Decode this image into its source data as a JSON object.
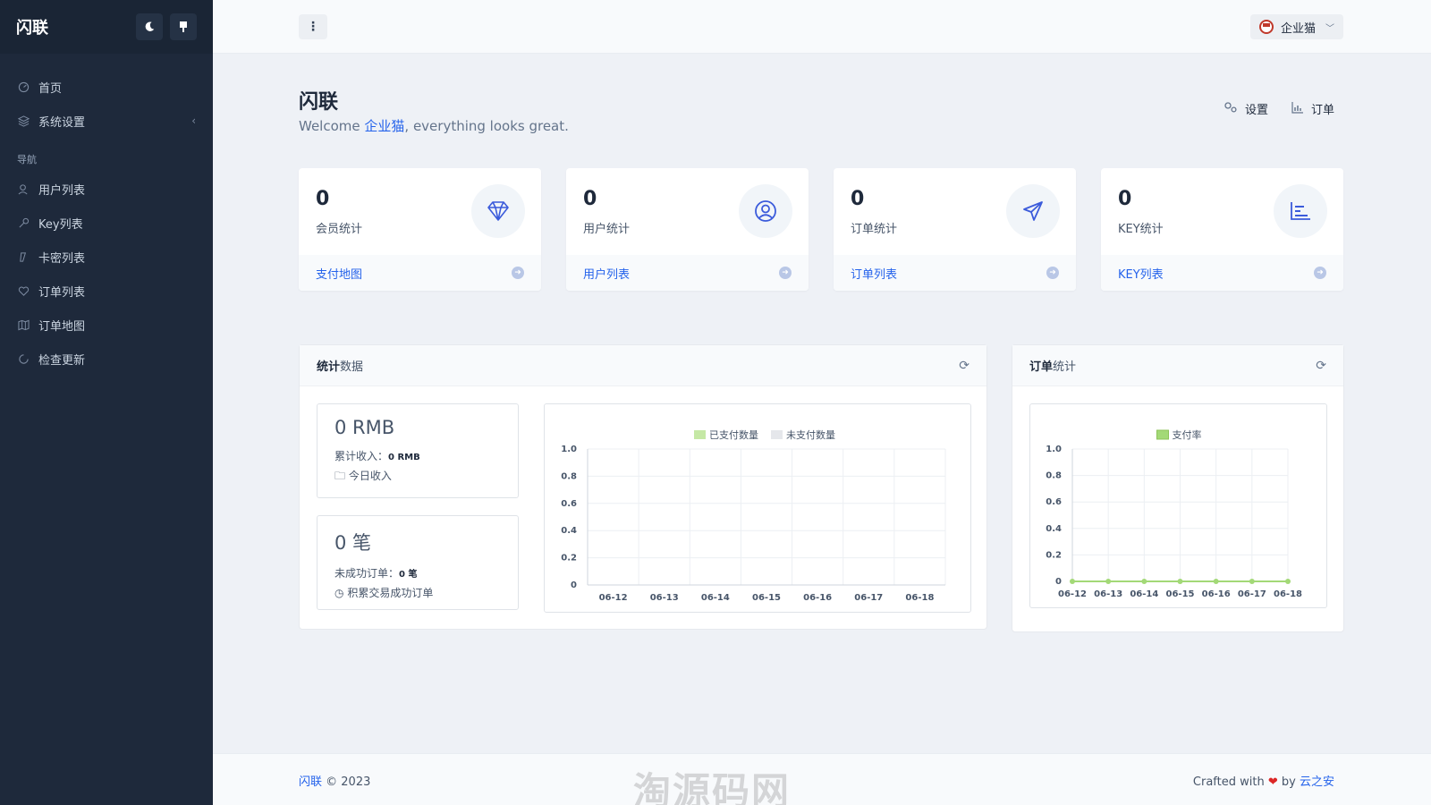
{
  "sidebar": {
    "brand": "闪联",
    "items": [
      {
        "label": "首页",
        "icon": "dashboard-icon"
      },
      {
        "label": "系统设置",
        "icon": "layers-icon"
      }
    ],
    "nav_heading": "导航",
    "nav_items": [
      {
        "label": "用户列表",
        "icon": "users-icon"
      },
      {
        "label": "Key列表",
        "icon": "key-icon"
      },
      {
        "label": "卡密列表",
        "icon": "ticket-icon"
      },
      {
        "label": "订单列表",
        "icon": "heart-icon"
      },
      {
        "label": "订单地图",
        "icon": "map-icon"
      },
      {
        "label": "检查更新",
        "icon": "update-icon"
      }
    ]
  },
  "topbar": {
    "user_name": "企业猫"
  },
  "page": {
    "title": "闪联",
    "welcome_prefix": "Welcome ",
    "welcome_user": "企业猫",
    "welcome_suffix": ", everything looks great.",
    "action_settings": "设置",
    "action_orders": "订单"
  },
  "cards": [
    {
      "value": "0",
      "label": "会员统计",
      "link": "支付地图",
      "icon": "diamond-icon"
    },
    {
      "value": "0",
      "label": "用户统计",
      "link": "用户列表",
      "icon": "user-circle-icon"
    },
    {
      "value": "0",
      "label": "订单统计",
      "link": "订单列表",
      "icon": "paper-plane-icon"
    },
    {
      "value": "0",
      "label": "KEY统计",
      "link": "KEY列表",
      "icon": "bar-chart-icon"
    }
  ],
  "stats_panel": {
    "title_bold": "统计",
    "title_rest": "数据",
    "revenue_big": "0 RMB",
    "revenue_total_label": "累计收入：",
    "revenue_total_value": "0 RMB",
    "revenue_today": "今日收入",
    "orders_big": "0 笔",
    "orders_failed_label": "未成功订单：",
    "orders_failed_value": "0 笔",
    "orders_success": "积累交易成功订单"
  },
  "orders_panel": {
    "title_bold": "订单",
    "title_rest": "统计"
  },
  "footer": {
    "brand": "闪联",
    "copyright": " © 2023",
    "crafted": "Crafted with ",
    "by": " by ",
    "author": "云之安",
    "watermark": "淘源码网"
  },
  "colors": {
    "paid": "#c5e8a5",
    "unpaid": "#e5e7eb",
    "rate": "#a3d977"
  },
  "chart_data": [
    {
      "type": "bar",
      "categories": [
        "06-12",
        "06-13",
        "06-14",
        "06-15",
        "06-16",
        "06-17",
        "06-18"
      ],
      "series": [
        {
          "name": "已支付数量",
          "values": [
            0,
            0,
            0,
            0,
            0,
            0,
            0
          ]
        },
        {
          "name": "未支付数量",
          "values": [
            0,
            0,
            0,
            0,
            0,
            0,
            0
          ]
        }
      ],
      "yticks": [
        "0",
        "0.2",
        "0.4",
        "0.6",
        "0.8",
        "1.0"
      ],
      "ylim": [
        0,
        1
      ],
      "legend": "top"
    },
    {
      "type": "line",
      "categories": [
        "06-12",
        "06-13",
        "06-14",
        "06-15",
        "06-16",
        "06-17",
        "06-18"
      ],
      "series": [
        {
          "name": "支付率",
          "values": [
            0,
            0,
            0,
            0,
            0,
            0,
            0
          ]
        }
      ],
      "yticks": [
        "0",
        "0.2",
        "0.4",
        "0.6",
        "0.8",
        "1.0"
      ],
      "ylim": [
        0,
        1
      ],
      "legend": "top"
    }
  ]
}
